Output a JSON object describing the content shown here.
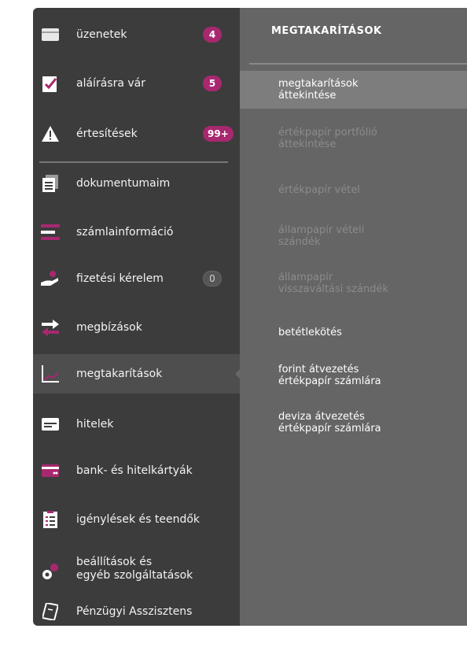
{
  "sidebar": {
    "items": [
      {
        "label": "üzenetek",
        "badge": "4",
        "icon": "envelope-icon"
      },
      {
        "label": "aláírásra vár",
        "badge": "5",
        "icon": "signature-check-icon"
      },
      {
        "label": "értesítések",
        "badge": "99+",
        "icon": "warning-icon"
      },
      {
        "label": "dokumentumaim",
        "icon": "documents-icon"
      },
      {
        "label": "számlainformáció",
        "icon": "account-info-icon"
      },
      {
        "label": "fizetési kérelem",
        "badge": "0",
        "icon": "payment-request-icon"
      },
      {
        "label": "megbízások",
        "icon": "transfer-arrows-icon"
      },
      {
        "label": "megtakarítások",
        "icon": "savings-chart-icon",
        "active": true
      },
      {
        "label": "hitelek",
        "icon": "loan-icon"
      },
      {
        "label": "bank- és hitelkártyák",
        "icon": "card-icon"
      },
      {
        "label": "igénylések és teendők",
        "icon": "checklist-icon"
      },
      {
        "label": "beállítások és\negyéb szolgáltatások",
        "icon": "settings-gear-icon"
      },
      {
        "label": "Pénzügyi Asszisztens",
        "icon": "assistant-book-icon"
      }
    ]
  },
  "submenu": {
    "title": "MEGTAKARÍTÁSOK",
    "items": [
      {
        "label": "megtakarítások\náttekintése",
        "state": "selected"
      },
      {
        "label": "értékpapír portfólió\náttekintése",
        "state": "disabled"
      },
      {
        "label": "értékpapír vétel",
        "state": "disabled"
      },
      {
        "label": "állampapír vételi\nszándék",
        "state": "disabled"
      },
      {
        "label": "állampapír\nvisszaváltási szándék",
        "state": "disabled"
      },
      {
        "label": "betétlekötés",
        "state": "enabled"
      },
      {
        "label": "forint átvezetés\nértékpapír számlára",
        "state": "enabled"
      },
      {
        "label": "deviza átvezetés\nértékpapír számlára",
        "state": "enabled"
      }
    ]
  },
  "colors": {
    "accent": "#a8286f",
    "sidebar_bg": "#3c3c3c",
    "panel_bg": "#656565"
  }
}
